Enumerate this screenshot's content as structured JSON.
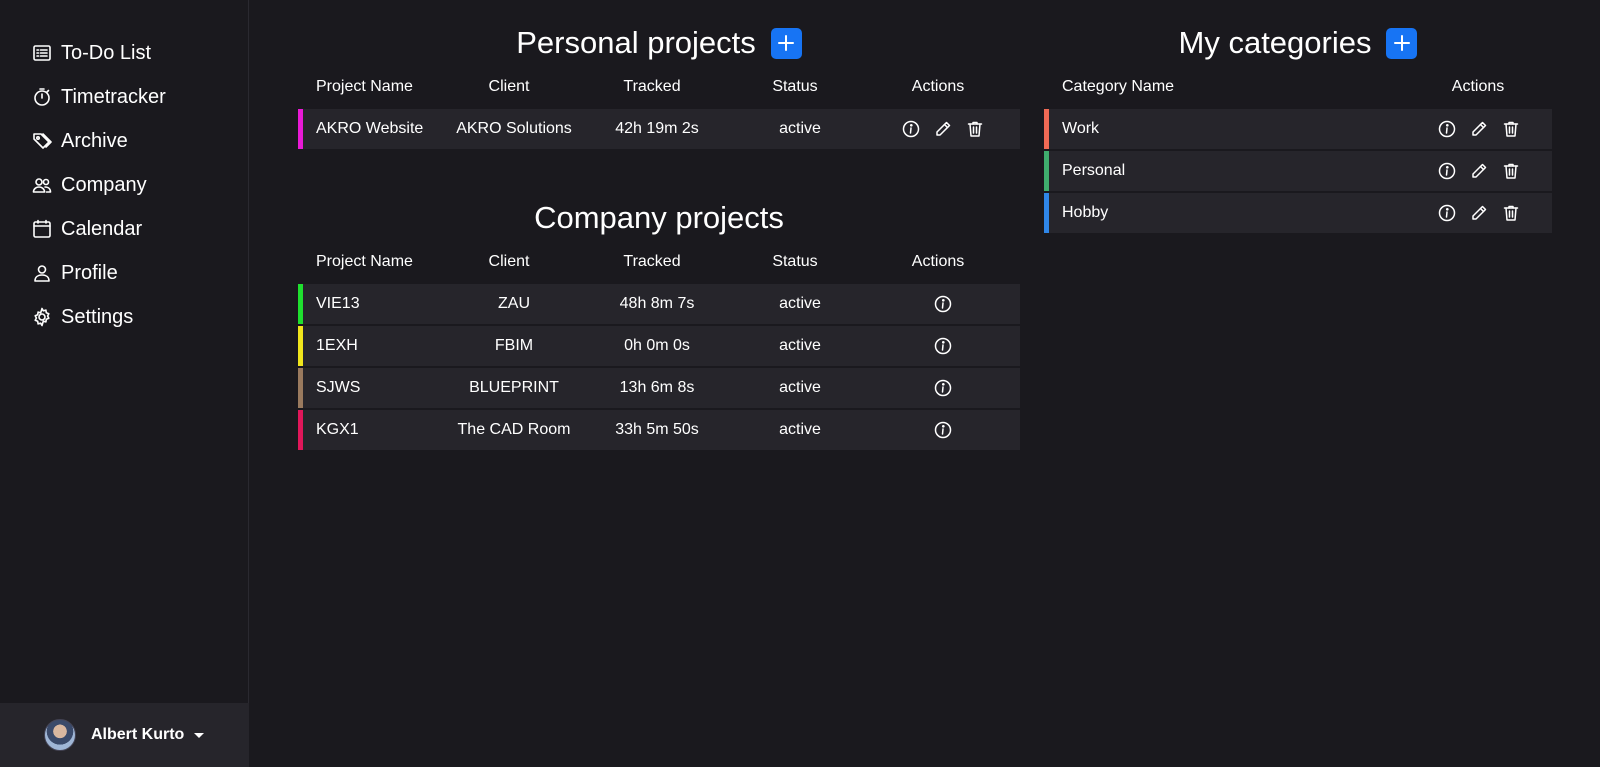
{
  "sidebar": {
    "items": [
      {
        "label": "To-Do List",
        "icon": "list-icon"
      },
      {
        "label": "Timetracker",
        "icon": "stopwatch-icon"
      },
      {
        "label": "Archive",
        "icon": "tags-icon"
      },
      {
        "label": "Company",
        "icon": "people-icon"
      },
      {
        "label": "Calendar",
        "icon": "calendar-icon"
      },
      {
        "label": "Profile",
        "icon": "person-icon"
      },
      {
        "label": "Settings",
        "icon": "gear-icon"
      }
    ],
    "user": {
      "name": "Albert Kurto"
    }
  },
  "personal": {
    "title": "Personal projects",
    "headers": {
      "name": "Project Name",
      "client": "Client",
      "tracked": "Tracked",
      "status": "Status",
      "actions": "Actions"
    },
    "rows": [
      {
        "name": "AKRO Website",
        "client": "AKRO Solutions",
        "tracked": "42h 19m 2s",
        "status": "active",
        "color": "#e91ad6"
      }
    ]
  },
  "company": {
    "title": "Company projects",
    "headers": {
      "name": "Project Name",
      "client": "Client",
      "tracked": "Tracked",
      "status": "Status",
      "actions": "Actions"
    },
    "rows": [
      {
        "name": "VIE13",
        "client": "ZAU",
        "tracked": "48h 8m 7s",
        "status": "active",
        "color": "#1fe02f"
      },
      {
        "name": "1EXH",
        "client": "FBIM",
        "tracked": "0h 0m 0s",
        "status": "active",
        "color": "#f0e51c"
      },
      {
        "name": "SJWS",
        "client": "BLUEPRINT",
        "tracked": "13h 6m 8s",
        "status": "active",
        "color": "#9a7a5e"
      },
      {
        "name": "KGX1",
        "client": "The CAD Room",
        "tracked": "33h 5m 50s",
        "status": "active",
        "color": "#e0175a"
      }
    ]
  },
  "categories": {
    "title": "My categories",
    "headers": {
      "name": "Category Name",
      "actions": "Actions"
    },
    "rows": [
      {
        "name": "Work",
        "color": "#f06a55"
      },
      {
        "name": "Personal",
        "color": "#3fae6e"
      },
      {
        "name": "Hobby",
        "color": "#2f86e8"
      }
    ]
  },
  "colors": {
    "accent": "#1774f4",
    "background": "#1a191e",
    "row": "#26252b"
  }
}
